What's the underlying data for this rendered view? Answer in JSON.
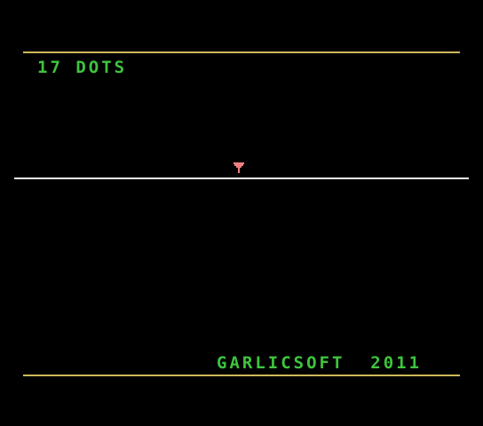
{
  "game": {
    "title": "17 DOTS",
    "credit": "GARLICSOFT  2011"
  },
  "colors": {
    "background": "#000000",
    "text": "#3ec43e",
    "border": "#cdb85a",
    "horizon": "#f2f2f2",
    "player": "#f08080"
  },
  "icons": {
    "player": "funnel-ship-icon"
  }
}
